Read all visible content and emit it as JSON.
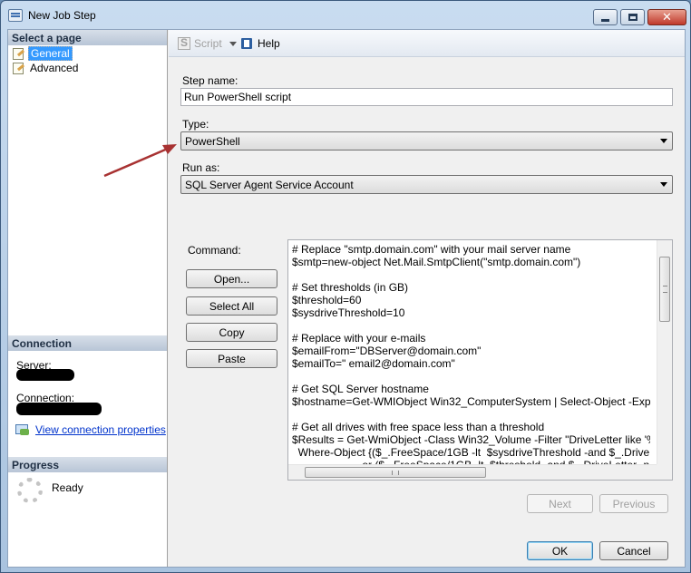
{
  "window": {
    "title": "New Job Step"
  },
  "left_pane": {
    "select_page_header": "Select a page",
    "pages": [
      {
        "label": "General",
        "selected": true
      },
      {
        "label": "Advanced",
        "selected": false
      }
    ],
    "connection_header": "Connection",
    "server_label": "Server:",
    "connection_label": "Connection:",
    "view_connection_link": "View connection properties",
    "progress_header": "Progress",
    "progress_status": "Ready"
  },
  "toolbar": {
    "script_label": "Script",
    "help_label": "Help"
  },
  "form": {
    "step_name_label": "Step name:",
    "step_name_value": "Run PowerShell script",
    "type_label": "Type:",
    "type_value": "PowerShell",
    "run_as_label": "Run as:",
    "run_as_value": "SQL Server Agent Service Account",
    "command_label": "Command:",
    "command_text": "# Replace \"smtp.domain.com\" with your mail server name\n$smtp=new-object Net.Mail.SmtpClient(\"smtp.domain.com\")\n\n# Set thresholds (in GB)\n$threshold=60\n$sysdriveThreshold=10\n\n# Replace with your e-mails\n$emailFrom=\"DBServer@domain.com\"\n$emailTo=\" email2@domain.com\"\n\n# Get SQL Server hostname\n$hostname=Get-WMIObject Win32_ComputerSystem | Select-Object -ExpandProperty name\n\n# Get all drives with free space less than a threshold\n$Results = Get-WmiObject -Class Win32_Volume -Filter \"DriveLetter like '%:%' AND DriveType=3\" |\n  Where-Object {($_.FreeSpace/1GB -lt  $sysdriveThreshold -and $_.DriveLetter -eq 'C:') `\n                      -or ($_.FreeSpace/1GB -lt  $threshold -and $_.DriveLetter -ne 'C:')}",
    "open_button": "Open...",
    "select_all_button": "Select All",
    "copy_button": "Copy",
    "paste_button": "Paste",
    "next_button": "Next",
    "previous_button": "Previous"
  },
  "footer": {
    "ok_button": "OK",
    "cancel_button": "Cancel"
  },
  "colors": {
    "annotation_arrow": "#a83232",
    "selection": "#3399ff",
    "link": "#0033cc"
  }
}
